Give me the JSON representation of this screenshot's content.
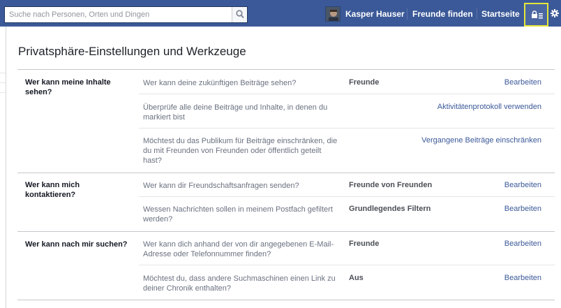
{
  "topbar": {
    "search_placeholder": "Suche nach Personen, Orten und Dingen",
    "user_name": "Kasper Hauser",
    "find_friends": "Freunde finden",
    "home": "Startseite"
  },
  "page": {
    "title": "Privatsphäre-Einstellungen und Werkzeuge"
  },
  "sections": [
    {
      "title": "Wer kann meine Inhalte sehen?",
      "rows": [
        {
          "question": "Wer kann deine zukünftigen Beiträge sehen?",
          "value": "Freunde",
          "action": "Bearbeiten"
        },
        {
          "question": "Überprüfe alle deine Beiträge und Inhalte, in denen du markiert bist",
          "value": "",
          "action": "Aktivitätenprotokoll verwenden"
        },
        {
          "question": "Möchtest du das Publikum für Beiträge einschränken, die du mit Freunden von Freunden oder öffentlich geteilt hast?",
          "value": "",
          "action": "Vergangene Beiträge einschränken"
        }
      ]
    },
    {
      "title": "Wer kann mich kontaktieren?",
      "rows": [
        {
          "question": "Wer kann dir Freundschaftsanfragen senden?",
          "value": "Freunde von Freunden",
          "action": "Bearbeiten"
        },
        {
          "question": "Wessen Nachrichten sollen in meinem Postfach gefiltert werden?",
          "value": "Grundlegendes Filtern",
          "action": "Bearbeiten"
        }
      ]
    },
    {
      "title": "Wer kann nach mir suchen?",
      "rows": [
        {
          "question": "Wer kann dich anhand der von dir angegebenen E-Mail-Adresse oder Telefonnummer finden?",
          "value": "Freunde",
          "action": "Bearbeiten"
        },
        {
          "question": "Möchtest du, dass andere Suchmaschinen einen Link zu deiner Chronik enthalten?",
          "value": "Aus",
          "action": "Bearbeiten"
        }
      ]
    }
  ],
  "colors": {
    "topbar": "#3b5998",
    "link": "#3b5998",
    "highlight": "#e5e73a"
  },
  "icons": {
    "search": "magnifier-icon",
    "privacy": "lock-menu-icon",
    "settings": "gear-icon"
  }
}
